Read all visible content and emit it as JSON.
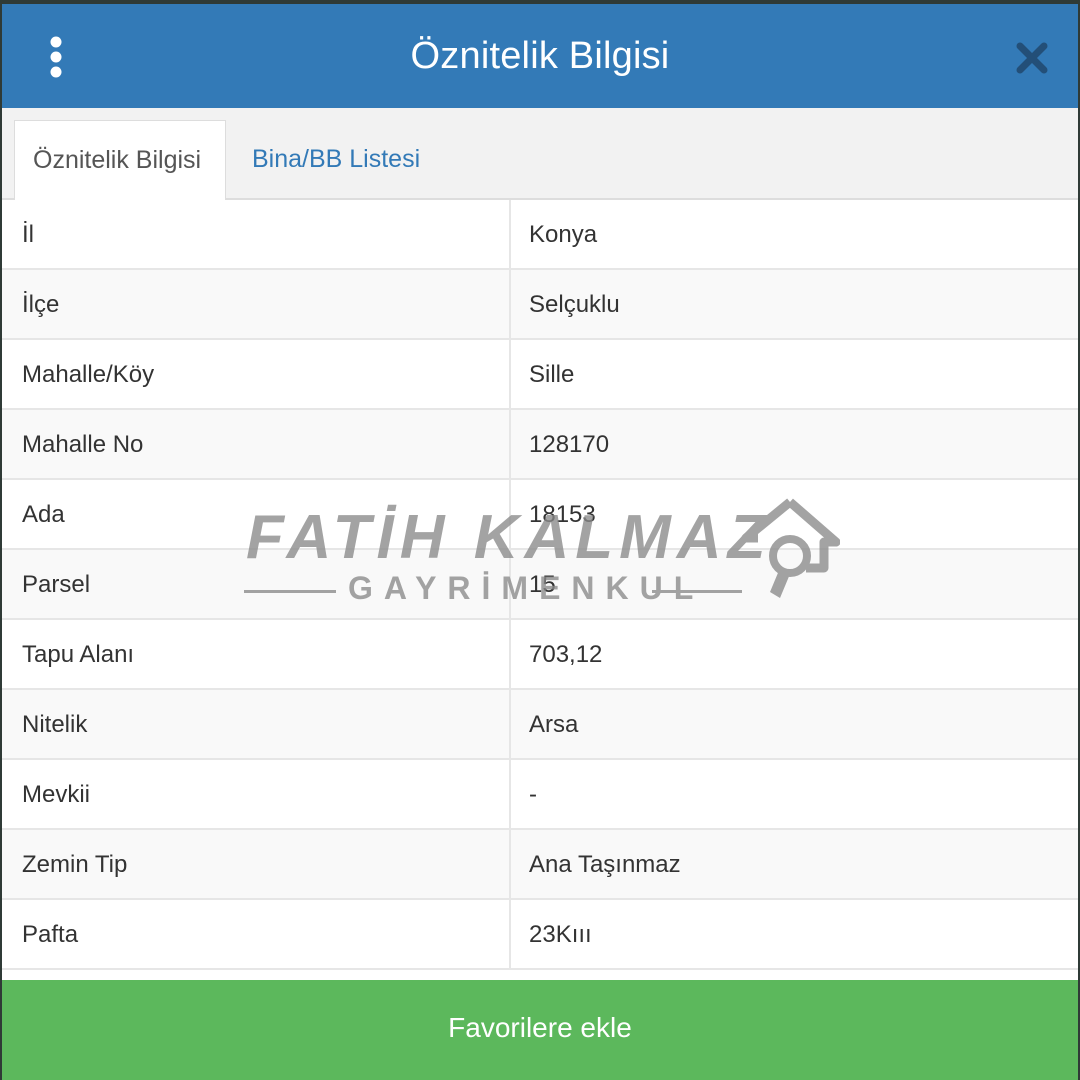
{
  "header": {
    "title": "Öznitelik Bilgisi",
    "menu_icon": "vertical-dots-icon",
    "close_icon": "close-icon",
    "bg_color": "#337ab7"
  },
  "tabs": [
    {
      "label": "Öznitelik Bilgisi",
      "active": true
    },
    {
      "label": "Bina/BB Listesi",
      "active": false
    }
  ],
  "rows": [
    {
      "label": "İl",
      "value": "Konya"
    },
    {
      "label": "İlçe",
      "value": "Selçuklu"
    },
    {
      "label": "Mahalle/Köy",
      "value": "Sille"
    },
    {
      "label": "Mahalle No",
      "value": "128170"
    },
    {
      "label": "Ada",
      "value": "18153"
    },
    {
      "label": "Parsel",
      "value": "15"
    },
    {
      "label": "Tapu Alanı",
      "value": "703,12"
    },
    {
      "label": "Nitelik",
      "value": "Arsa"
    },
    {
      "label": "Mevkii",
      "value": "-"
    },
    {
      "label": "Zemin Tip",
      "value": "Ana Taşınmaz"
    },
    {
      "label": "Pafta",
      "value": "23Kııı"
    }
  ],
  "footer": {
    "button_label": "Favorilere ekle",
    "bg_color": "#5cb85c"
  },
  "watermark": {
    "line1": "FATİH KALMAZ",
    "line2": "GAYRİMENKUL",
    "logo_icon": "house-magnifier-icon"
  }
}
